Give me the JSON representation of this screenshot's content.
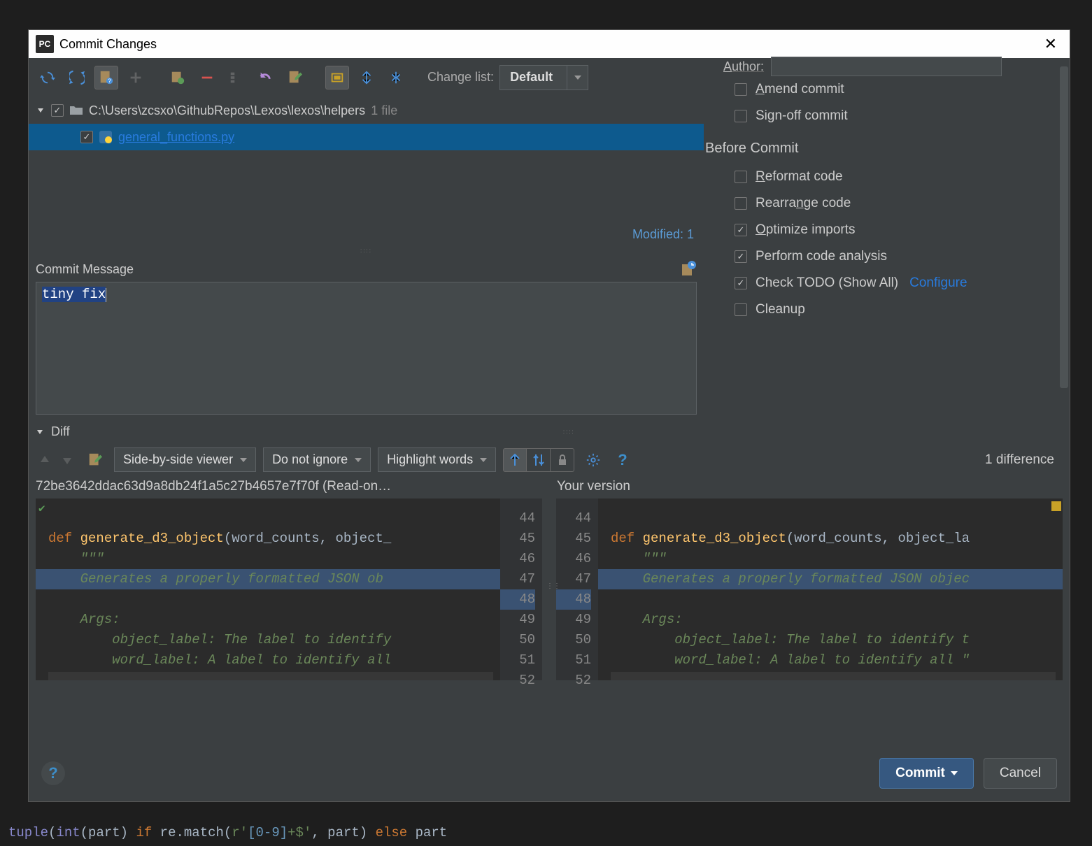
{
  "titlebar": {
    "title": "Commit Changes"
  },
  "toolbar": {
    "change_list_label": "Change list:",
    "change_list_value": "Default"
  },
  "tree": {
    "root_path": "C:\\Users\\zcsxo\\GithubRepos\\Lexos\\lexos\\helpers",
    "root_count": "1 file",
    "file_name": "general_functions.py",
    "modified": "Modified: 1"
  },
  "commit_message": {
    "label": "Commit Message",
    "value": "tiny fix"
  },
  "right": {
    "author_label": "Author:",
    "amend": "Amend commit",
    "signoff": "Sign-off commit",
    "before_commit": "Before Commit",
    "reformat": "Reformat code",
    "rearrange": "Rearrange code",
    "optimize": "Optimize imports",
    "analyze": "Perform code analysis",
    "todo": "Check TODO (Show All)",
    "configure": "Configure",
    "cleanup": "Cleanup"
  },
  "diff": {
    "section": "Diff",
    "viewer": "Side-by-side viewer",
    "ignore": "Do not ignore",
    "highlight": "Highlight words",
    "count": "1 difference",
    "left_title": "72be3642ddac63d9a8db24f1a5c27b4657e7f70f (Read-on…",
    "right_title": "Your version",
    "line_numbers": [
      "44",
      "45",
      "46",
      "47",
      "48",
      "49",
      "50",
      "51",
      "52"
    ],
    "code": {
      "def": "def ",
      "fn": "generate_d3_object",
      "params_left": "(word_counts, object_",
      "params_right": "(word_counts, object_la",
      "triple": "    \"\"\"",
      "doc_left": "    Generates a properly formatted JSON ob",
      "doc_right": "    Generates a properly formatted JSON objec",
      "args": "    Args:",
      "obj_left": "        object_label: The label to identify",
      "obj_right": "        object_label: The label to identify t",
      "word_left": "        word_label: A label to identify all",
      "word_right": "        word_label: A label to identify all \""
    }
  },
  "buttons": {
    "commit": "Commit",
    "cancel": "Cancel"
  },
  "bg_bottom": "tuple(int(part) if re.match(r'[0-9]+$', part) else part"
}
